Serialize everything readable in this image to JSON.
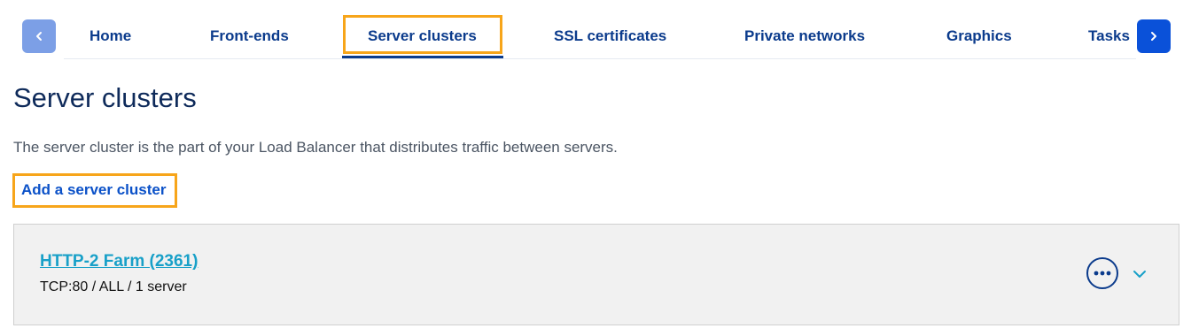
{
  "nav": {
    "prev_icon": "chevron-left-icon",
    "next_icon": "chevron-right-icon",
    "tabs": [
      {
        "label": "Home"
      },
      {
        "label": "Front-ends"
      },
      {
        "label": "Server clusters",
        "active": true
      },
      {
        "label": "SSL certificates"
      },
      {
        "label": "Private networks"
      },
      {
        "label": "Graphics"
      },
      {
        "label": "Tasks"
      }
    ]
  },
  "page": {
    "title": "Server clusters",
    "description": "The server cluster is the part of your Load Balancer that distributes traffic between servers.",
    "add_link": "Add a server cluster"
  },
  "clusters": [
    {
      "name": "HTTP-2 Farm (2361)",
      "summary": "TCP:80 / ALL / 1 server",
      "actions_icon": "more-options-icon",
      "expand_icon": "chevron-down-icon"
    }
  ],
  "colors": {
    "accent": "#0b3b8c",
    "link": "#0b51c8",
    "cluster_link": "#18a0c8",
    "highlight": "#f7a51a"
  }
}
